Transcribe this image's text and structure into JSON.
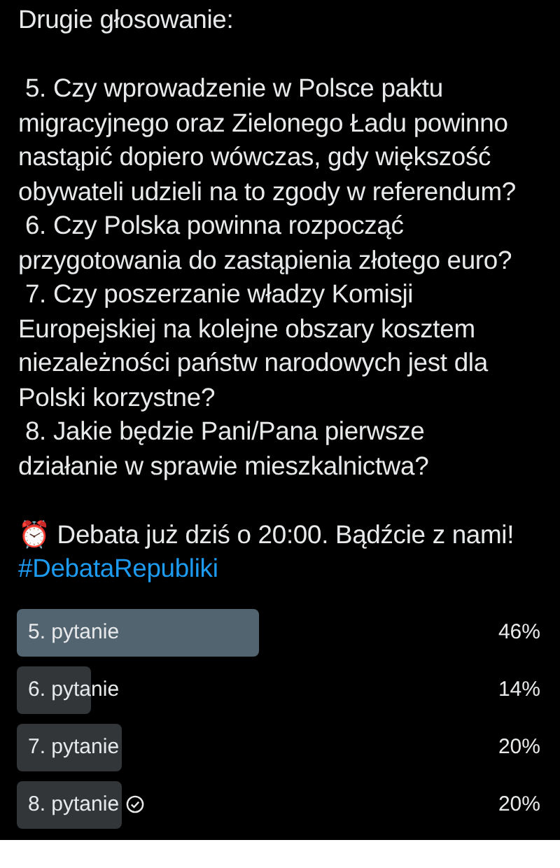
{
  "post": {
    "paragraphs": [
      {
        "kind": "text",
        "text": "Drugie głosowanie:"
      },
      {
        "kind": "text",
        "text": " 5. Czy wprowadzenie w Polsce paktu migracyjnego oraz Zielonego Ładu powinno nastąpić dopiero wówczas, gdy większość obywateli udzieli na to zgody w referendum?\n 6. Czy Polska powinna rozpocząć przygotowania do zastąpienia złotego euro?\n 7. Czy poszerzanie władzy Komisji Europejskiej na kolejne obszary kosztem niezależności państw narodowych jest dla Polski korzystne?\n 8. Jakie będzie Pani/Pana pierwsze działanie w sprawie mieszkalnictwa?"
      },
      {
        "kind": "text",
        "text": "⏰ Debata już dziś o 20:00. Bądźcie z nami!"
      },
      {
        "kind": "hashtag",
        "text": "#DebataRepubliki"
      }
    ]
  },
  "poll": {
    "options": [
      {
        "label": "5. pytanie",
        "level": 0.46,
        "percent": "46%",
        "selected": false
      },
      {
        "label": "6. pytanie",
        "level": 0.14,
        "percent": "14%",
        "selected": false
      },
      {
        "label": "7. pytanie",
        "level": 0.2,
        "percent": "20%",
        "selected": false
      },
      {
        "label": "8. pytanie",
        "level": 0.2,
        "percent": "20%",
        "selected": true
      }
    ]
  }
}
